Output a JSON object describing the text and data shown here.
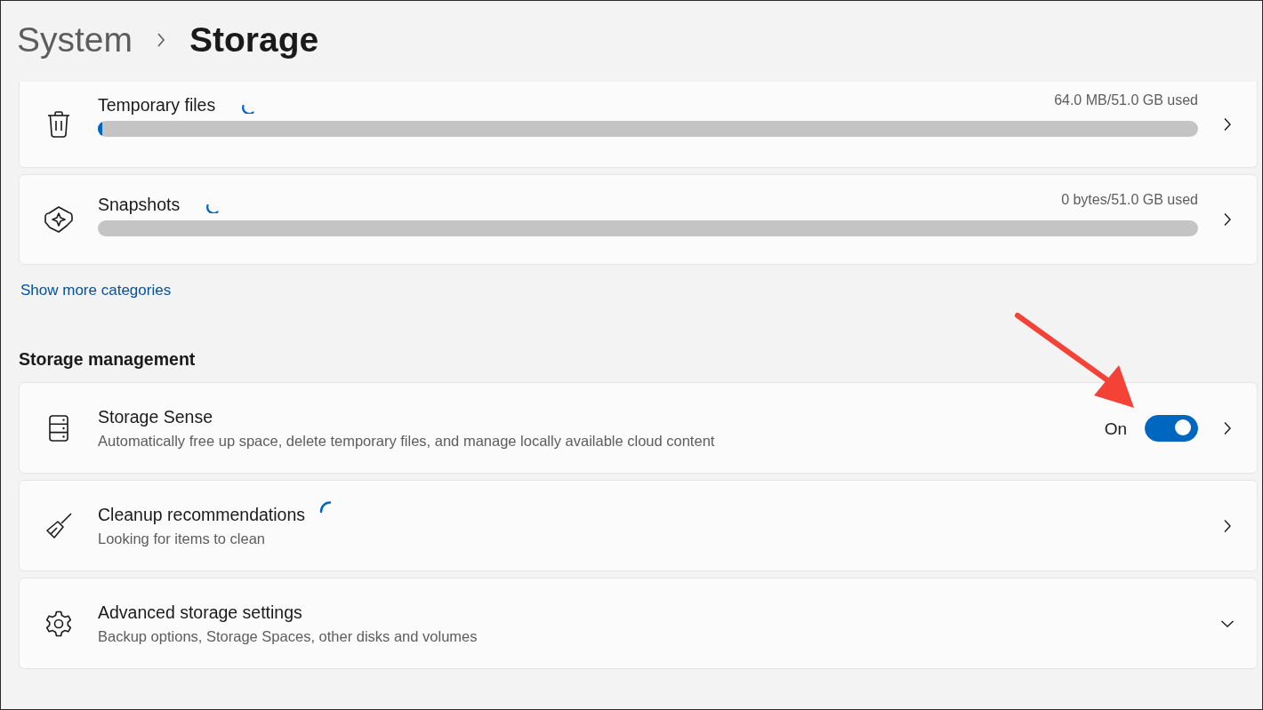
{
  "breadcrumb": [
    {
      "label": "System"
    },
    {
      "label": "Storage"
    }
  ],
  "categories": [
    {
      "label": "Temporary files",
      "loading": true,
      "usage": "64.0 MB/51.0 GB used",
      "level": 0.004
    },
    {
      "label": "Snapshots",
      "loading": true,
      "usage": "0 bytes/51.0 GB used",
      "level": 0
    }
  ],
  "show_more_link": "Show more categories",
  "section_title": "Storage management",
  "settings": [
    {
      "kind": "toggle",
      "label": "Storage Sense",
      "description": "Automatically free up space, delete temporary files, and manage locally available cloud content",
      "toggle_label": "On",
      "on": true
    },
    {
      "kind": "link",
      "label": "Cleanup recommendations",
      "loading": true,
      "description": "Looking for items to clean"
    },
    {
      "kind": "expander",
      "label": "Advanced storage settings",
      "description": "Backup options, Storage Spaces, other disks and volumes",
      "expanded": false
    }
  ]
}
